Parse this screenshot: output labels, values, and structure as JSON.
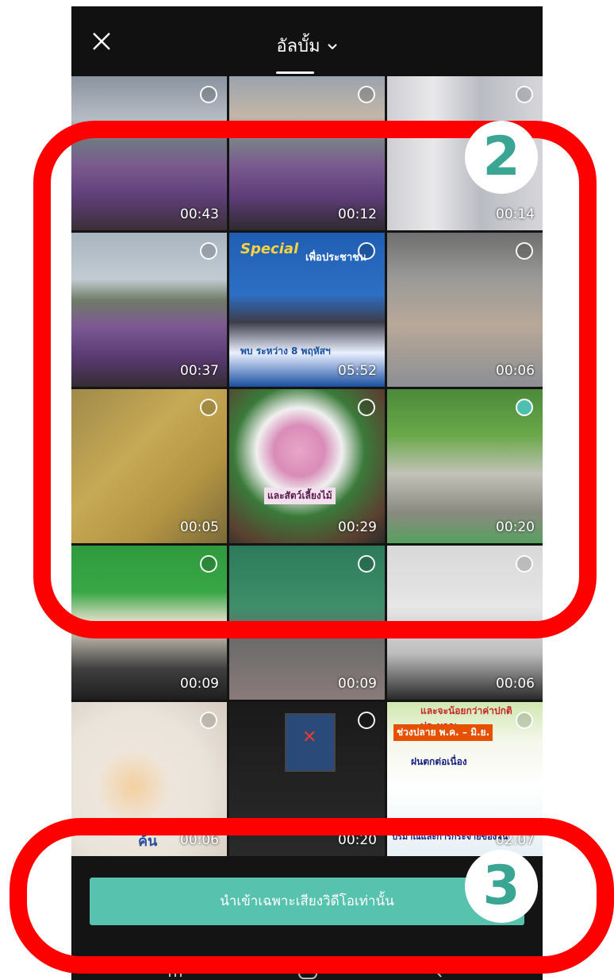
{
  "header": {
    "title": "อัลบั้ม",
    "close_icon": "close-icon",
    "dropdown_icon": "chevron-down-icon"
  },
  "tiles": [
    {
      "duration": "00:43"
    },
    {
      "duration": "00:12"
    },
    {
      "duration": "00:14"
    },
    {
      "duration": "00:37"
    },
    {
      "duration": "05:52",
      "text_top": "Special",
      "text_mid": "เพื่อประชาชน",
      "text_bottom": "พบ ระหว่าง 8 พฤหัสฯ"
    },
    {
      "duration": "00:06"
    },
    {
      "duration": "00:05"
    },
    {
      "duration": "00:29",
      "text_mid": "และสัตว์เลี้ยงไม้"
    },
    {
      "duration": "00:20",
      "selected": true
    },
    {
      "duration": "00:09"
    },
    {
      "duration": "00:09"
    },
    {
      "duration": "00:06"
    },
    {
      "duration": "00:06",
      "text_bottom": "ค้น"
    },
    {
      "duration": "00:20"
    },
    {
      "duration": "02:07",
      "text_top": "และจะน้อยกว่าค่าปกติประมาณ",
      "text_mid": "ช่วงปลาย พ.ค. – มิ.ย.",
      "text_sub": "ฝนตกต่อเนื่อง",
      "text_bottom": "ปริมาณและการกระจายของฝน"
    }
  ],
  "bottom": {
    "import_audio_label": "นำเข้าเฉพาะเสียงวิดีโอเท่านั้น"
  },
  "annotations": {
    "badge_2": "2",
    "badge_3": "3"
  },
  "colors": {
    "accent": "#57c2ae",
    "annotation_red": "#ff0000",
    "badge_text": "#3aa593"
  }
}
